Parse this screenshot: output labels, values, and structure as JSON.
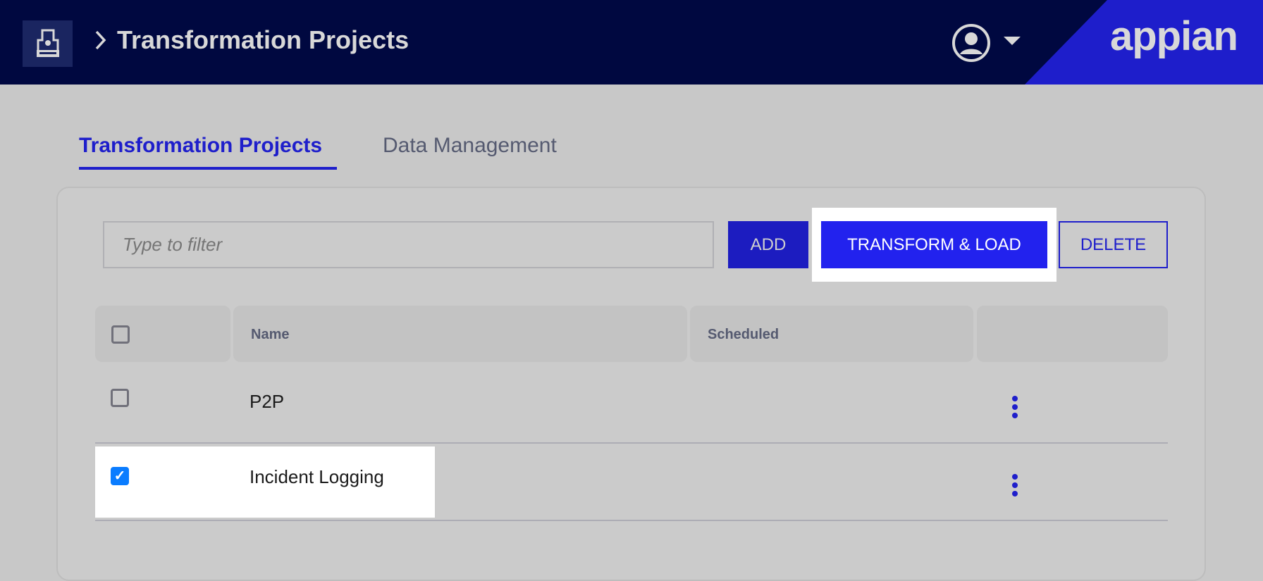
{
  "header": {
    "breadcrumb_title": "Transformation Projects",
    "brand": "appian",
    "brand_color": "#1e1ecb",
    "bar_color": "#000840"
  },
  "tabs": [
    {
      "label": "Transformation Projects",
      "active": true
    },
    {
      "label": "Data Management",
      "active": false
    }
  ],
  "toolbar": {
    "filter_placeholder": "Type to filter",
    "add_label": "ADD",
    "transform_label": "TRANSFORM & LOAD",
    "delete_label": "DELETE"
  },
  "table": {
    "columns": [
      "",
      "Name",
      "Scheduled",
      ""
    ],
    "rows": [
      {
        "name": "P2P",
        "scheduled": "",
        "checked": false
      },
      {
        "name": "Incident Logging",
        "scheduled": "",
        "checked": true
      }
    ]
  }
}
